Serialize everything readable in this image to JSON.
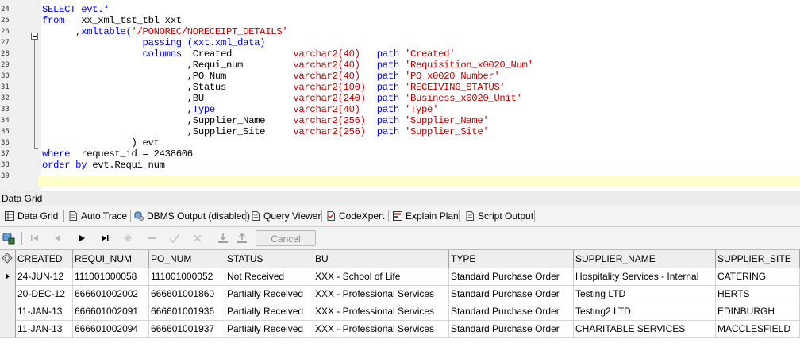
{
  "editor": {
    "line_numbers": [
      "24",
      "25",
      "26",
      "27",
      "28",
      "29",
      "30",
      "31",
      "32",
      "33",
      "34",
      "35",
      "36",
      "37",
      "38",
      "39"
    ],
    "lines": [
      [
        {
          "t": "SELECT evt.*",
          "c": "kw"
        }
      ],
      [
        {
          "t": "from   ",
          "c": "kw"
        },
        {
          "t": "xx_xml_tst_tbl xxt",
          "c": "plain"
        }
      ],
      [
        {
          "t": "      ,",
          "c": "plain"
        },
        {
          "t": "xmltable(",
          "c": "kw"
        },
        {
          "t": "'/PONOREC/NORECEIPT_DETAILS'",
          "c": "str"
        }
      ],
      [
        {
          "t": "                  passing (xxt.xml_data)",
          "c": "kw"
        }
      ],
      [
        {
          "t": "                  columns  ",
          "c": "kw"
        },
        {
          "t": "Created           ",
          "c": "plain"
        },
        {
          "t": "varchar2(40)   ",
          "c": "str"
        },
        {
          "t": "path ",
          "c": "kw"
        },
        {
          "t": "'Created'",
          "c": "str"
        }
      ],
      [
        {
          "t": "                          ,Requi_num         ",
          "c": "plain"
        },
        {
          "t": "varchar2(40)   ",
          "c": "str"
        },
        {
          "t": "path ",
          "c": "kw"
        },
        {
          "t": "'Requisition_x0020_Num'",
          "c": "str"
        }
      ],
      [
        {
          "t": "                          ,PO_Num            ",
          "c": "plain"
        },
        {
          "t": "varchar2(40)   ",
          "c": "str"
        },
        {
          "t": "path ",
          "c": "kw"
        },
        {
          "t": "'PO_x0020_Number'",
          "c": "str"
        }
      ],
      [
        {
          "t": "                          ,Status            ",
          "c": "plain"
        },
        {
          "t": "varchar2(100)  ",
          "c": "str"
        },
        {
          "t": "path ",
          "c": "kw"
        },
        {
          "t": "'RECEIVING_STATUS'",
          "c": "str"
        }
      ],
      [
        {
          "t": "                          ,BU                ",
          "c": "plain"
        },
        {
          "t": "varchar2(240)  ",
          "c": "str"
        },
        {
          "t": "path ",
          "c": "kw"
        },
        {
          "t": "'Business_x0020_Unit'",
          "c": "str"
        }
      ],
      [
        {
          "t": "                          ,",
          "c": "plain"
        },
        {
          "t": "Type              ",
          "c": "kw"
        },
        {
          "t": "varchar2(40)   ",
          "c": "str"
        },
        {
          "t": "path ",
          "c": "kw"
        },
        {
          "t": "'Type'",
          "c": "str"
        }
      ],
      [
        {
          "t": "                          ,Supplier_Name     ",
          "c": "plain"
        },
        {
          "t": "varchar2(256)  ",
          "c": "str"
        },
        {
          "t": "path ",
          "c": "kw"
        },
        {
          "t": "'Supplier_Name'",
          "c": "str"
        }
      ],
      [
        {
          "t": "                          ,Supplier_Site     ",
          "c": "plain"
        },
        {
          "t": "varchar2(256)  ",
          "c": "str"
        },
        {
          "t": "path ",
          "c": "kw"
        },
        {
          "t": "'Supplier_Site'",
          "c": "str"
        }
      ],
      [
        {
          "t": "                ) evt",
          "c": "plain"
        }
      ],
      [
        {
          "t": "where  ",
          "c": "kw"
        },
        {
          "t": "request_id = 2438606",
          "c": "plain"
        }
      ],
      [
        {
          "t": "order by ",
          "c": "kw"
        },
        {
          "t": "evt.Requi_num",
          "c": "plain"
        }
      ],
      []
    ]
  },
  "panel": {
    "title": "Data Grid"
  },
  "tabs": [
    {
      "label": "Data Grid",
      "icon": "grid-icon"
    },
    {
      "label": "Auto Trace",
      "icon": "document-icon"
    },
    {
      "label": "DBMS Output (disabled)",
      "icon": "database-icon"
    },
    {
      "label": "Query Viewer",
      "icon": "document-icon"
    },
    {
      "label": "CodeXpert",
      "icon": "codexpert-icon"
    },
    {
      "label": "Explain Plan",
      "icon": "explain-plan-icon"
    },
    {
      "label": "Script Output",
      "icon": "document-icon"
    }
  ],
  "toolbar": {
    "cancel_label": "Cancel"
  },
  "grid": {
    "columns": [
      "CREATED",
      "REQUI_NUM",
      "PO_NUM",
      "STATUS",
      "BU",
      "TYPE",
      "SUPPLIER_NAME",
      "SUPPLIER_SITE"
    ],
    "rows": [
      [
        "24-JUN-12",
        "111001000058",
        "111001000052",
        "Not Received",
        "XXX - School of Life",
        "Standard Purchase Order",
        "Hospitality Services - Internal",
        "CATERING"
      ],
      [
        "20-DEC-12",
        "666601002002",
        "666601001860",
        "Partially Received",
        "XXX - Professional Services",
        "Standard Purchase Order",
        "Testing LTD",
        "HERTS"
      ],
      [
        "11-JAN-13",
        "666601002091",
        "666601001936",
        "Partially Received",
        "XXX - Professional Services",
        "Standard Purchase Order",
        "Testing2 LTD",
        "EDINBURGH"
      ],
      [
        "11-JAN-13",
        "666601002094",
        "666601001937",
        "Partially Received",
        "XXX - Professional Services",
        "Standard Purchase Order",
        "CHARITABLE SERVICES",
        "MACCLESFIELD"
      ]
    ],
    "current_row": 0
  }
}
